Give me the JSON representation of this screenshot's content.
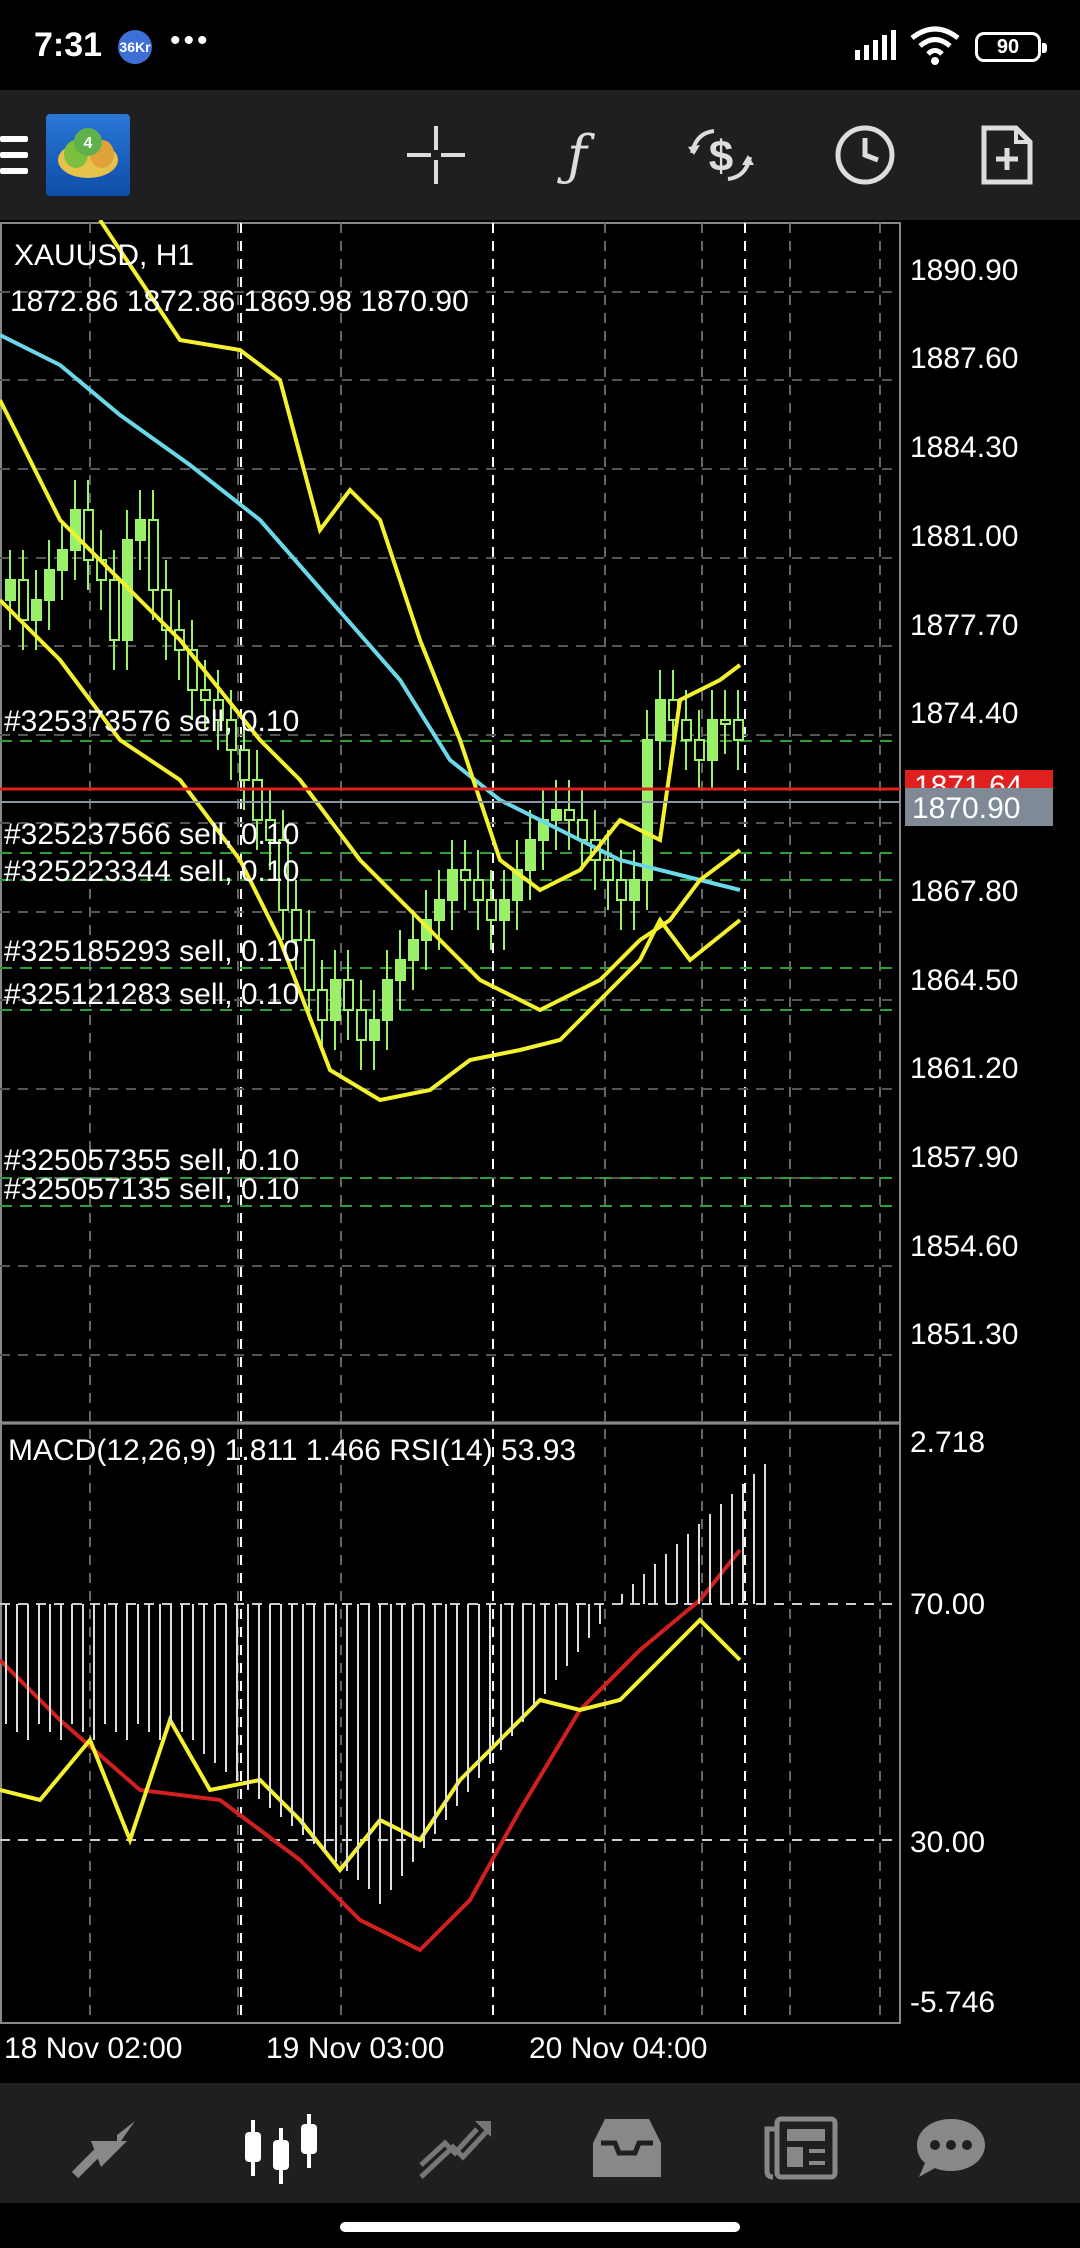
{
  "status_bar": {
    "time": "7:31",
    "badge": "36Kr",
    "dots": "•••",
    "battery": "90"
  },
  "chart_header": {
    "symbol": "XAUUSD, H1",
    "ohlc": "1872.86 1872.86 1869.98 1870.90",
    "indicator": "MACD(12,26,9) 1.811 1.466 RSI(14) 53.93"
  },
  "colors": {
    "bid_line": "#e0201e",
    "ask_label_bg": "#7f8a96",
    "ma": "#6ad8e8",
    "bands": "#f4f12e",
    "candles": "#9bf06a",
    "signal": "#d22020",
    "rsi": "#f4f12e"
  },
  "price_axis": [
    "1890.90",
    "1887.60",
    "1884.30",
    "1881.00",
    "1877.70",
    "1874.40",
    "1867.80",
    "1864.50",
    "1861.20",
    "1857.90",
    "1854.60",
    "1851.30"
  ],
  "current_prices": {
    "bid": "1871.64",
    "ask": "1870.90"
  },
  "orders": [
    "#325373576 sell, 0.10",
    "#325237566 sell, 0.10",
    "#325223344 sell, 0.10",
    "#325185293 sell, 0.10",
    "#325121283 sell, 0.10",
    "#325057355 sell, 0.10",
    "#325057135 sell, 0.10"
  ],
  "indicator_axis": {
    "top": "2.718",
    "high": "70.00",
    "low": "30.00",
    "bottom": "-5.746"
  },
  "time_axis": [
    "18 Nov 02:00",
    "19 Nov 03:00",
    "20 Nov 04:00"
  ],
  "toolbar": [
    "menu-icon",
    "crosshair-icon",
    "function-icon",
    "trade-icon",
    "clock-icon",
    "new-order-icon"
  ],
  "nav": [
    "quotes-icon",
    "chart-icon",
    "trade-icon",
    "history-icon",
    "news-icon",
    "chat-icon"
  ]
}
